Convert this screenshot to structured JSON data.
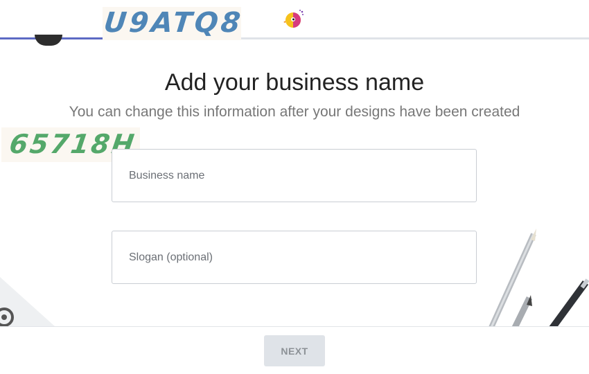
{
  "header": {
    "captcha_top_text": "U9ATQ8",
    "progress_fraction": 0.174,
    "logo_icon": "bird-logo-icon"
  },
  "overlay": {
    "captcha_left_text": "65718H"
  },
  "main": {
    "title": "Add your business name",
    "subtitle": "You can change this information after your designs have been created",
    "business_name": {
      "placeholder": "Business name",
      "value": ""
    },
    "slogan": {
      "placeholder": "Slogan (optional)",
      "value": ""
    }
  },
  "footer": {
    "next_label": "NEXT",
    "next_disabled": true
  },
  "colors": {
    "accent": "#5c6ac4",
    "button_bg": "#dfe3e8",
    "button_text": "#8c9196"
  }
}
